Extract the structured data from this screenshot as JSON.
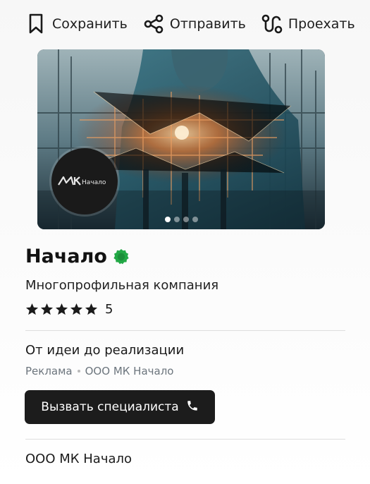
{
  "actions": {
    "save_label": "Сохранить",
    "share_label": "Отправить",
    "route_label": "Проехать"
  },
  "gallery": {
    "logo_text": "Начало",
    "logo_mark": "MK",
    "slides_total": 4,
    "active_slide": 1
  },
  "org": {
    "name": "Начало",
    "category": "Многопрофильная компания",
    "rating_value": "5",
    "rating_stars": 5,
    "verified_color": "#22a845"
  },
  "ad": {
    "headline": "От идеи до реализации",
    "label": "Реклама",
    "advertiser": "ООО МК Начало",
    "button_label": "Вызвать специалиста"
  },
  "footer": {
    "legal_name": "ООО МК Начало"
  }
}
